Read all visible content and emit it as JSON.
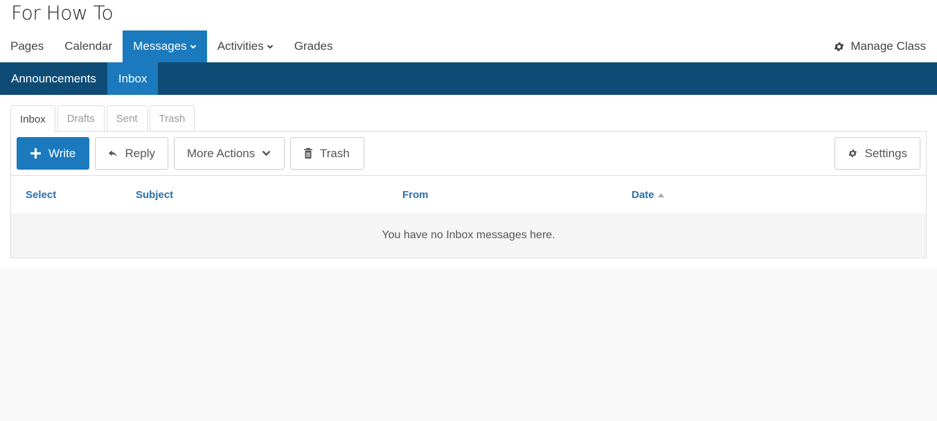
{
  "class_title": "For How To",
  "main_nav": {
    "pages": "Pages",
    "calendar": "Calendar",
    "messages": "Messages",
    "activities": "Activities",
    "grades": "Grades",
    "manage_class": "Manage Class"
  },
  "sub_nav": {
    "announcements": "Announcements",
    "inbox": "Inbox"
  },
  "tabs": {
    "inbox": "Inbox",
    "drafts": "Drafts",
    "sent": "Sent",
    "trash": "Trash"
  },
  "toolbar": {
    "write": "Write",
    "reply": "Reply",
    "more_actions": "More Actions",
    "trash": "Trash",
    "settings": "Settings"
  },
  "table": {
    "columns": {
      "select": "Select",
      "subject": "Subject",
      "from": "From",
      "date": "Date"
    },
    "sort_column": "Date",
    "sort_direction": "ascending",
    "empty_message": "You have no Inbox messages here."
  },
  "colors": {
    "accent": "#1a7abd",
    "subnav": "#0f4c75",
    "link": "#2a6fa8"
  }
}
